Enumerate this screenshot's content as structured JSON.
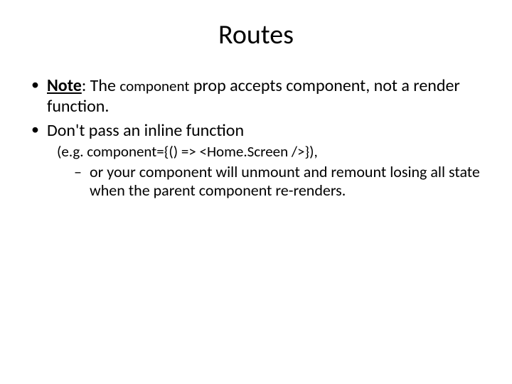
{
  "title": "Routes",
  "bullets": {
    "b1": {
      "note_label": "Note",
      "text_after_note": ": The ",
      "component_word": "component",
      "rest": " prop accepts component, not a render function."
    },
    "b2": {
      "main": "Don't pass an inline function",
      "example_prefix": "(e.g. ",
      "example_code": "component={() => <Home.Screen />}",
      "example_suffix": "),",
      "sub": " or your component will unmount and remount losing all state when the parent component re-renders."
    }
  }
}
